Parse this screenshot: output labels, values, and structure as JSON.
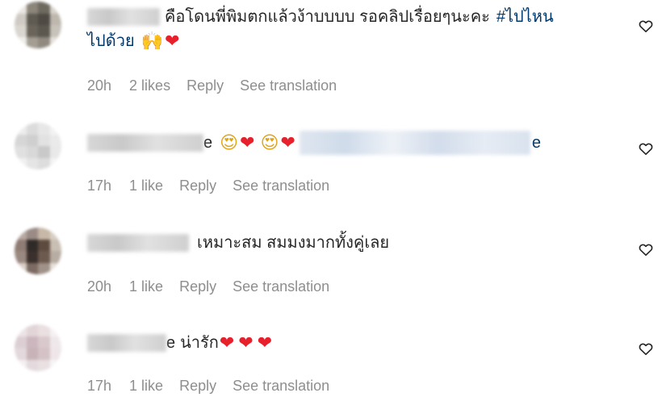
{
  "comments": [
    {
      "text": "คือโดนพี่พิมตกแล้วง้าบบบบ รอคลิปเรื่อยๆนะคะ",
      "hashtag": "#ไปไหนไปด้วย",
      "hashtag_part1": "#ไปไหน",
      "hashtag_part2": "ไปด้วย",
      "time": "20h",
      "likes": "2 likes",
      "reply": "Reply",
      "translate": "See translation"
    },
    {
      "text_tail": "e",
      "link_tail": "e",
      "time": "17h",
      "likes": "1 like",
      "reply": "Reply",
      "translate": "See translation"
    },
    {
      "text": "เหมาะสม สมมงมากทั้งคู่เลย",
      "time": "20h",
      "likes": "1 like",
      "reply": "Reply",
      "translate": "See translation"
    },
    {
      "text_tail": "e",
      "text": "น่ารัก",
      "time": "17h",
      "likes": "1 like",
      "reply": "Reply",
      "translate": "See translation"
    }
  ],
  "colors": {
    "text": "#262626",
    "muted": "#8e8e8e",
    "hashtag": "#00376b",
    "heart": "#e8202b"
  },
  "icons": {
    "like": "heart-outline-icon",
    "emoji_heart": "red-heart-emoji",
    "emoji_face": "heart-eyes-emoji",
    "emoji_hands": "hands-raised-emoji"
  }
}
